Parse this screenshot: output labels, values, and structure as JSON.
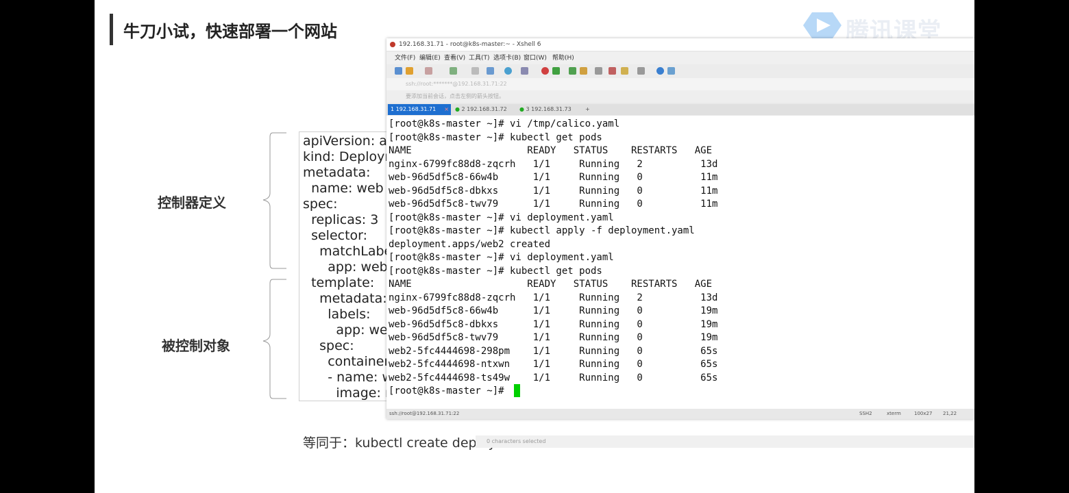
{
  "slide": {
    "title": "牛刀小试，快速部署一个网站",
    "logo_text": "腾讯课堂",
    "label_controller": "控制器定义",
    "label_controlled": "被控制对象",
    "equivalent_text": "等同于：kubectl create deploy"
  },
  "yaml_lines": [
    "apiVersion: ap",
    "kind: Deploym",
    "metadata:",
    "  name: web",
    "spec:",
    "  replicas: 3",
    "  selector:",
    "    matchLabe",
    "      app: web",
    "  template:",
    "    metadata:",
    "      labels:",
    "        app: web",
    "    spec:",
    "      containers",
    "      - name: w",
    "        image: n"
  ],
  "xshell": {
    "window_title": "192.168.31.71 - root@k8s-master:~ - Xshell 6",
    "menu": [
      "文件(F)",
      "编辑(E)",
      "查看(V)",
      "工具(T)",
      "选项卡(B)",
      "窗口(W)",
      "帮助(H)"
    ],
    "address": "ssh://root:*******@192.168.31.71:22",
    "hint": "要添加当前会话，点击左侧的箭头按钮。",
    "tabs": [
      "1 192.168.31.71",
      "2 192.168.31.72",
      "3 192.168.31.73"
    ],
    "terminal_lines": [
      "[root@k8s-master ~]# vi /tmp/calico.yaml",
      "[root@k8s-master ~]# kubectl get pods",
      "NAME                    READY   STATUS    RESTARTS   AGE",
      "nginx-6799fc88d8-zqcrh   1/1     Running   2          13d",
      "web-96d5df5c8-66w4b      1/1     Running   0          11m",
      "web-96d5df5c8-dbkxs      1/1     Running   0          11m",
      "web-96d5df5c8-twv79      1/1     Running   0          11m",
      "[root@k8s-master ~]# vi deployment.yaml",
      "[root@k8s-master ~]# kubectl apply -f deployment.yaml",
      "deployment.apps/web2 created",
      "[root@k8s-master ~]# vi deployment.yaml",
      "[root@k8s-master ~]# kubectl get pods",
      "NAME                    READY   STATUS    RESTARTS   AGE",
      "nginx-6799fc88d8-zqcrh   1/1     Running   2          13d",
      "web-96d5df5c8-66w4b      1/1     Running   0          19m",
      "web-96d5df5c8-dbkxs      1/1     Running   0          19m",
      "web-96d5df5c8-twv79      1/1     Running   0          19m",
      "web2-5fc4444698-298pm    1/1     Running   0          65s",
      "web2-5fc4444698-ntxwn    1/1     Running   0          65s",
      "web2-5fc4444698-ts49w    1/1     Running   0          65s",
      "[root@k8s-master ~]# "
    ],
    "status_left": "ssh://root@192.168.31.71:22",
    "status_right": [
      "SSH2",
      "xterm",
      "100x27",
      "21,22"
    ],
    "selection_text": "0 characters selected"
  },
  "colors": {
    "accent_tab": "#1e6fd0",
    "cursor": "#00d000",
    "logo": "#6aa8f0"
  }
}
